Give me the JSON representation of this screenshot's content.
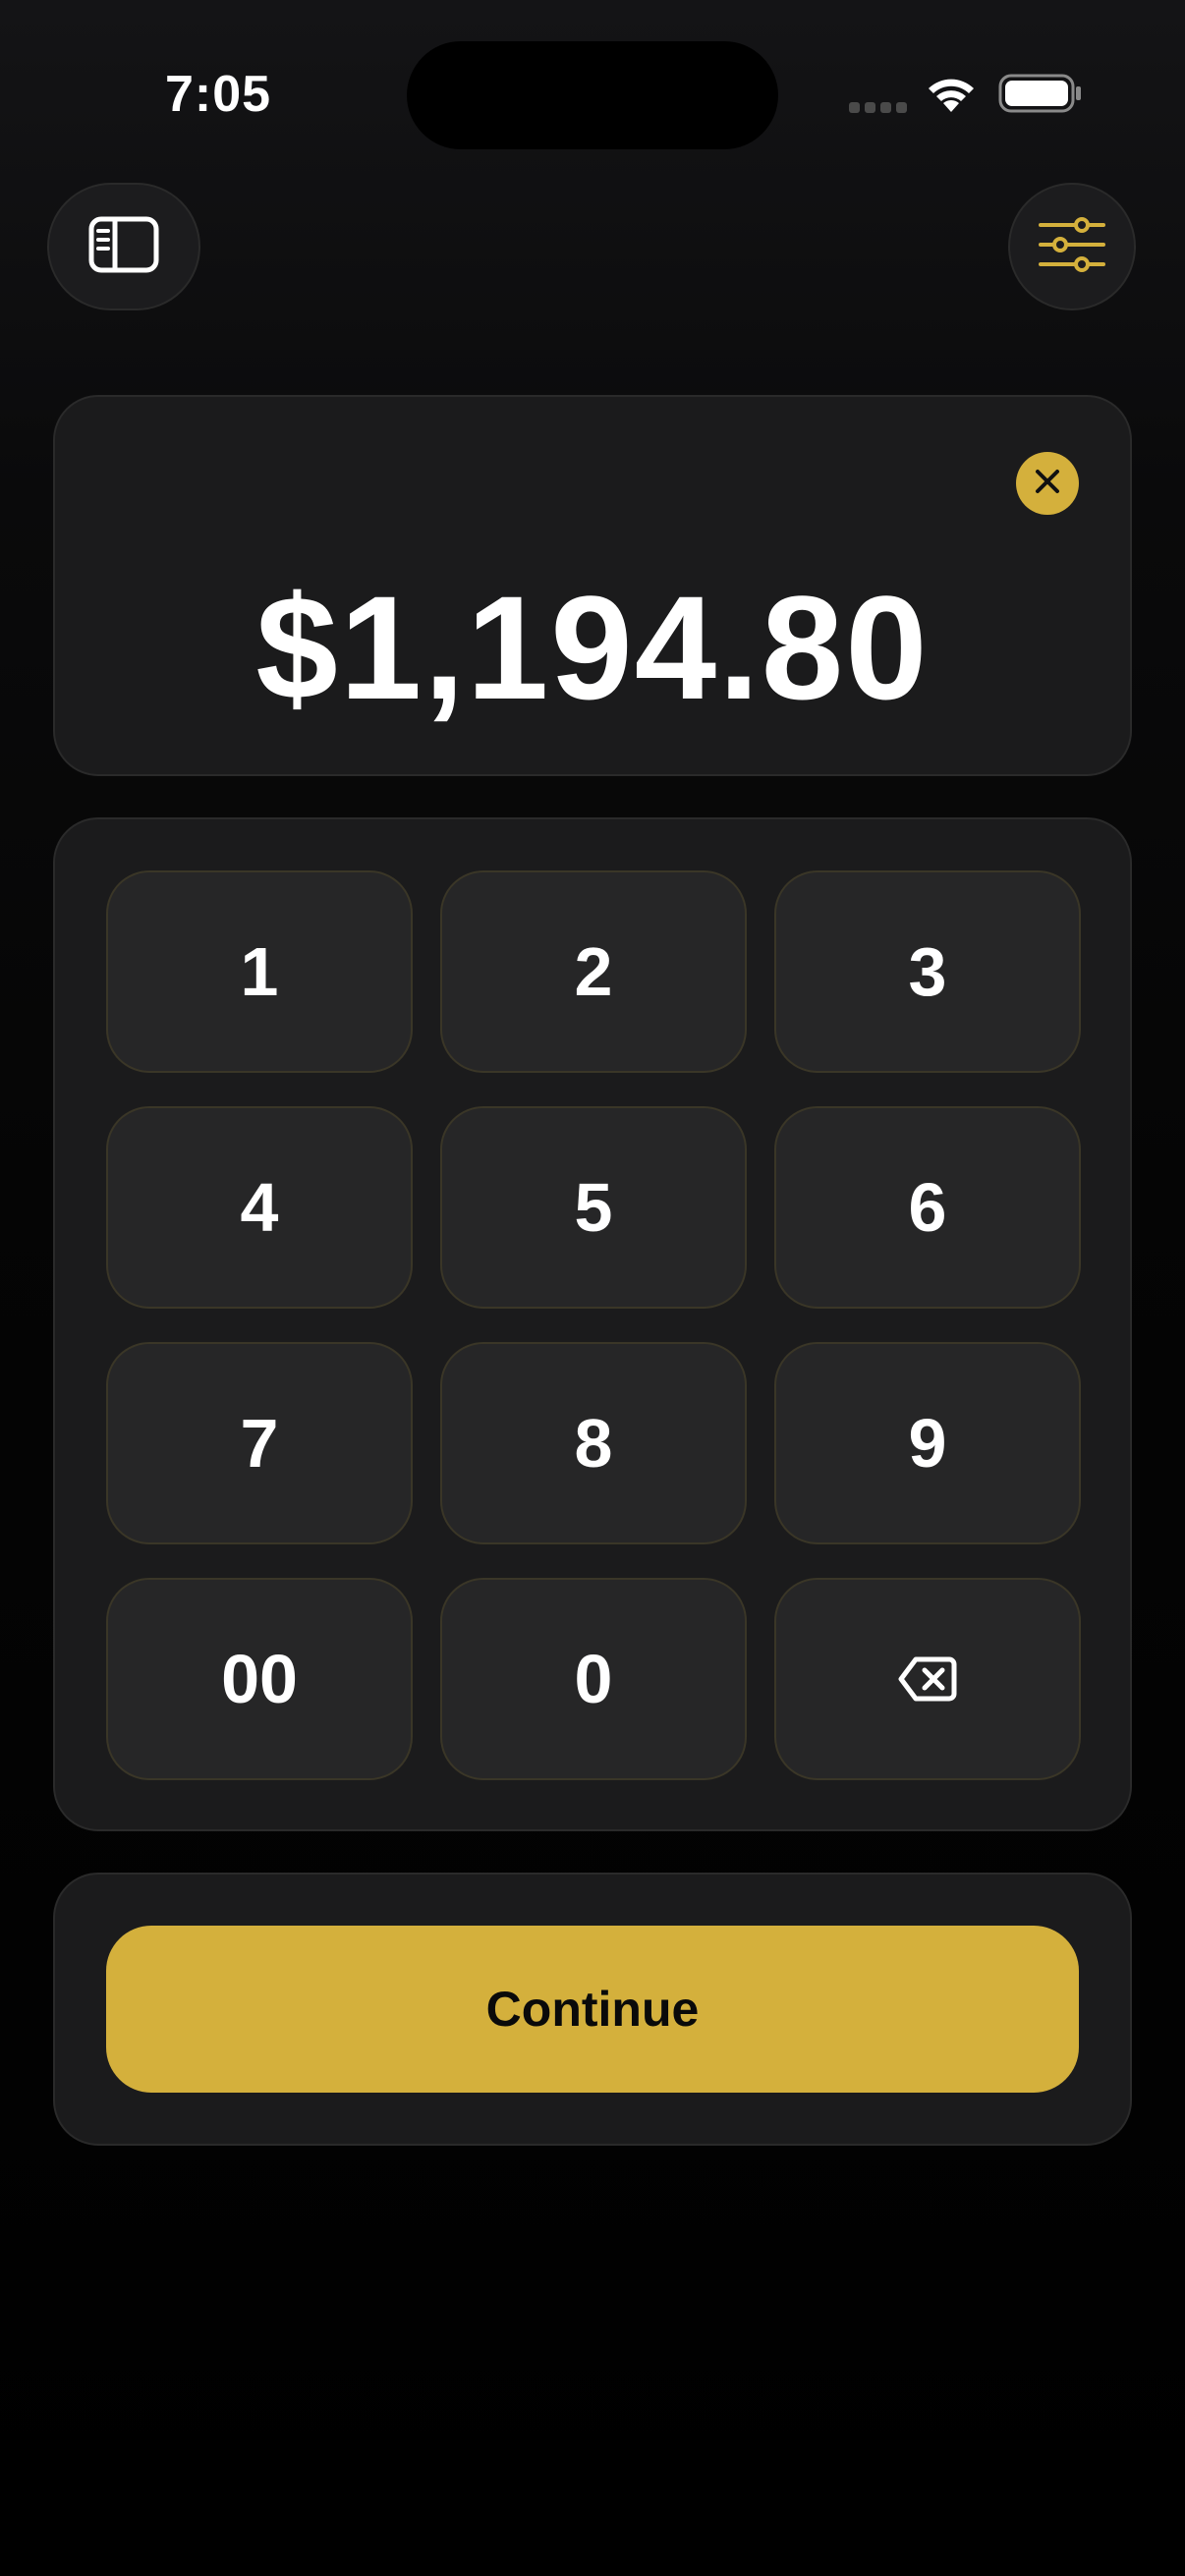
{
  "status_bar": {
    "time": "7:05",
    "icons": [
      "cellular-signal-icon",
      "wifi-icon",
      "battery-icon"
    ]
  },
  "header": {
    "left_button_icon": "sidebar-icon",
    "right_button_icon": "sliders-icon"
  },
  "amount_display": {
    "value": "$1,194.80",
    "clear_icon": "close-icon"
  },
  "keypad": {
    "keys": [
      "1",
      "2",
      "3",
      "4",
      "5",
      "6",
      "7",
      "8",
      "9",
      "00",
      "0"
    ],
    "backspace_icon": "backspace-icon"
  },
  "footer": {
    "continue_label": "Continue"
  },
  "colors": {
    "accent": "#d4b03c",
    "background": "#000000",
    "card": "#1b1b1c",
    "key": "#262627",
    "text": "#ffffff"
  }
}
